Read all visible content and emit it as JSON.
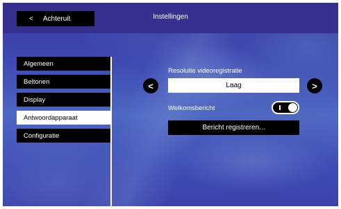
{
  "header": {
    "back_label": "Achteruit",
    "back_icon": "<",
    "title": "Instellingen"
  },
  "menu": {
    "items": [
      {
        "label": "Algemeen",
        "active": false
      },
      {
        "label": "Beltonen",
        "active": false
      },
      {
        "label": "Display",
        "active": false
      },
      {
        "label": "Antwoordapparaat",
        "active": true
      },
      {
        "label": "Configuratie",
        "active": false
      }
    ]
  },
  "settings": {
    "resolution_label": "Resolutie videoregistratie",
    "resolution_value": "Laag",
    "prev_icon": "<",
    "next_icon": ">",
    "welcome_label": "Welkomsbericht",
    "welcome_enabled": true,
    "record_button_label": "Bericht registreren..."
  },
  "colors": {
    "header_bg": "#36308f",
    "active_item_bg": "#ffffff",
    "item_bg": "#000000"
  }
}
